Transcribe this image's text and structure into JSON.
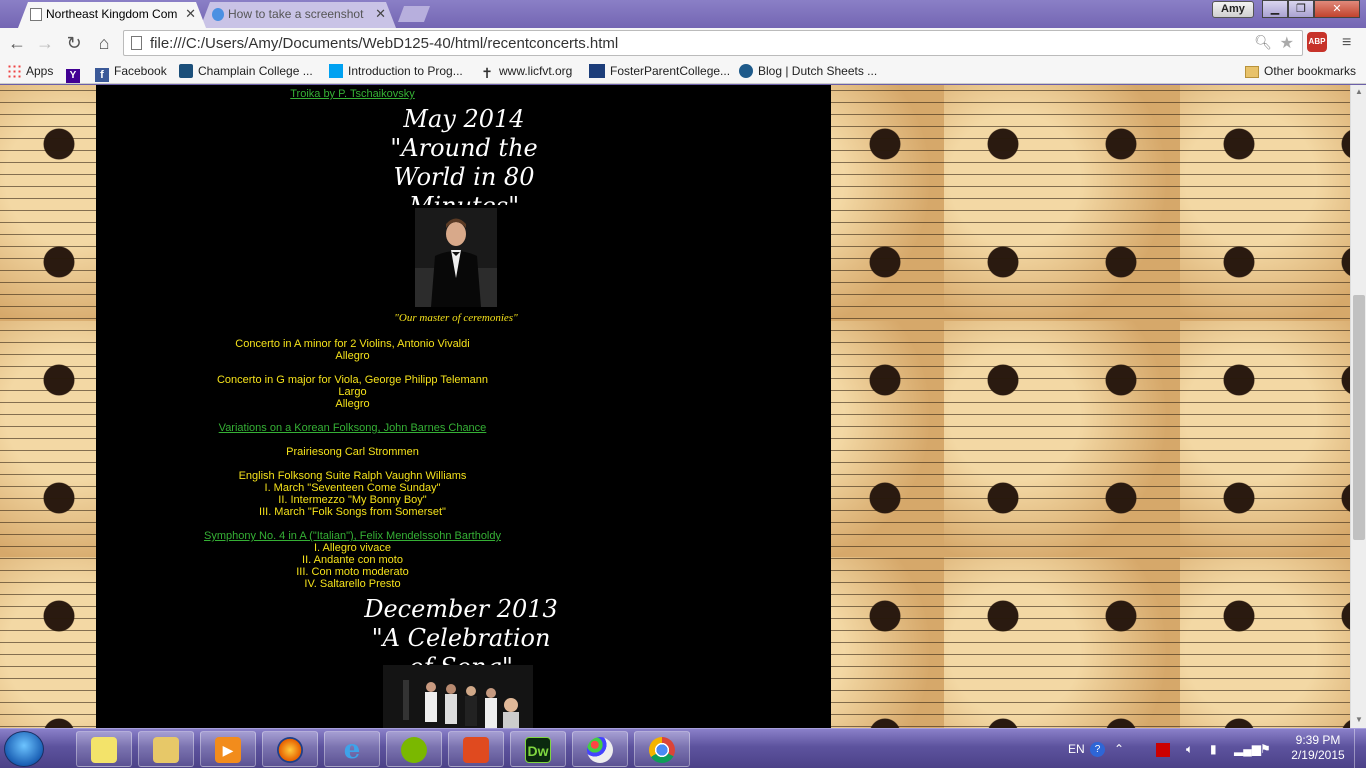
{
  "browser": {
    "tabs": [
      {
        "title": "Northeast Kingdom Com",
        "active": true
      },
      {
        "title": "How to take a screenshot",
        "active": false
      }
    ],
    "user": "Amy",
    "url": "file:///C:/Users/Amy/Documents/WebD125-40/html/recentconcerts.html",
    "abp_label": "ABP",
    "bookmarks": [
      {
        "label": "Apps",
        "icon": "apps-grid-icon"
      },
      {
        "label": "",
        "icon": "yahoo-icon"
      },
      {
        "label": "Facebook",
        "icon": "facebook-icon"
      },
      {
        "label": "Champlain College ...",
        "icon": "champlain-icon"
      },
      {
        "label": "Introduction to Prog...",
        "icon": "mva-icon"
      },
      {
        "label": "www.licfvt.org",
        "icon": "cross-icon"
      },
      {
        "label": "FosterParentCollege...",
        "icon": "fpc-icon"
      },
      {
        "label": "Blog | Dutch Sheets ...",
        "icon": "blog-icon"
      },
      {
        "label": "Other bookmarks",
        "icon": "folder-icon"
      }
    ]
  },
  "page": {
    "prev_link": "Troika by P. Tschaikovsky",
    "concert1": {
      "heading_lines": [
        "May 2014",
        "\"Around the",
        "World in 80",
        "Minutes\""
      ],
      "caption": "\"Our master of ceremonies\""
    },
    "program": [
      {
        "text": "Concerto in A minor for 2 Violins, Antonio Vivaldi",
        "link": false
      },
      {
        "text": "Allegro",
        "link": false
      },
      {
        "text": "Concerto in G major for Viola, George Philipp Telemann",
        "link": false
      },
      {
        "text": "Largo",
        "link": false
      },
      {
        "text": "Allegro",
        "link": false
      },
      {
        "text": "Variations on a Korean Folksong, John Barnes Chance",
        "link": true
      },
      {
        "text": "Prairiesong Carl Strommen",
        "link": false
      },
      {
        "text": "English Folksong Suite Ralph Vaughn Williams",
        "link": false
      },
      {
        "text": "I. March \"Seventeen Come Sunday\"",
        "link": false
      },
      {
        "text": "II. Intermezzo \"My Bonny Boy\"",
        "link": false
      },
      {
        "text": "III. March \"Folk Songs from Somerset\"",
        "link": false
      },
      {
        "text": "Symphony No. 4 in A (\"Italian\"), Felix Mendelssohn Bartholdy",
        "link": true
      },
      {
        "text": "I. Allegro vivace",
        "link": false
      },
      {
        "text": "II. Andante con moto",
        "link": false
      },
      {
        "text": "III. Con moto moderato",
        "link": false
      },
      {
        "text": "IV. Saltarello Presto",
        "link": false
      }
    ],
    "concert2": {
      "heading_lines": [
        "December 2013",
        "\"A Celebration",
        "of Song\""
      ]
    }
  },
  "taskbar": {
    "language": "EN",
    "time": "9:39 PM",
    "date": "2/19/2015",
    "apps": [
      "sticky-notes-icon",
      "explorer-icon",
      "media-player-icon",
      "firefox-icon",
      "ie-icon",
      "spotify-icon",
      "office-icon",
      "dreamweaver-icon",
      "paint-icon",
      "chrome-icon"
    ],
    "dw_label": "Dw"
  },
  "colors": {
    "program_text": "#f5e21b",
    "link": "#35b035",
    "page_bg": "#000000"
  }
}
